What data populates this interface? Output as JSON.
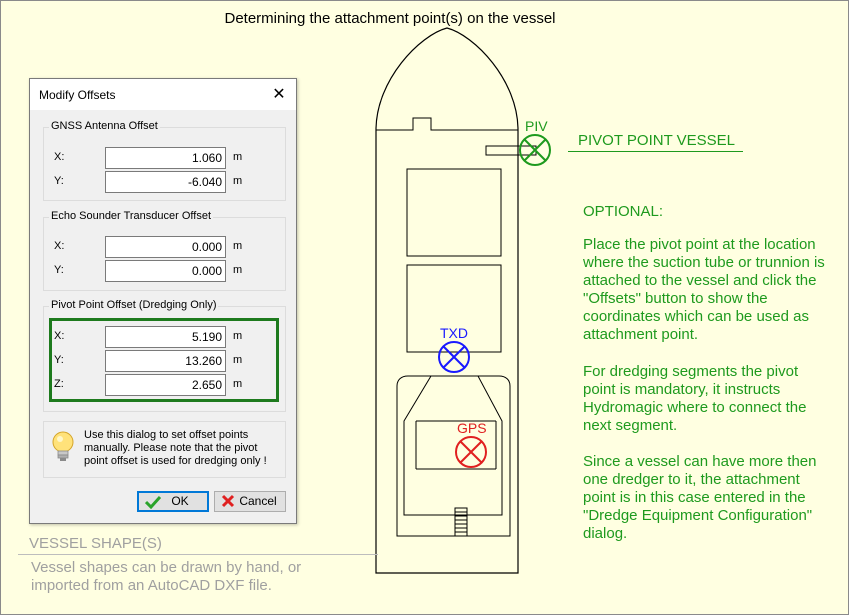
{
  "page": {
    "title": "Determining the attachment point(s) on the vessel"
  },
  "dialog": {
    "title": "Modify Offsets",
    "close_glyph": "✕",
    "gnss": {
      "label": "GNSS Antenna Offset",
      "rows": [
        {
          "axis": "X:",
          "value": "1.060",
          "unit": "m"
        },
        {
          "axis": "Y:",
          "value": "-6.040",
          "unit": "m"
        }
      ]
    },
    "echo": {
      "label": "Echo Sounder Transducer Offset",
      "rows": [
        {
          "axis": "X:",
          "value": "0.000",
          "unit": "m"
        },
        {
          "axis": "Y:",
          "value": "0.000",
          "unit": "m"
        }
      ]
    },
    "pivot": {
      "label": "Pivot Point Offset (Dredging Only)",
      "rows": [
        {
          "axis": "X:",
          "value": "5.190",
          "unit": "m"
        },
        {
          "axis": "Y:",
          "value": "13.260",
          "unit": "m"
        },
        {
          "axis": "Z:",
          "value": "2.650",
          "unit": "m"
        }
      ]
    },
    "tip": "Use this dialog to set offset points manually. Please note that the pivot point offset is used for dredging only !",
    "ok_label": "OK",
    "cancel_label": "Cancel"
  },
  "vessel": {
    "markers": {
      "pivot": "PIV",
      "transducer": "TXD",
      "gps": "GPS"
    }
  },
  "annotations": {
    "pivot_point_vessel": "PIVOT POINT VESSEL",
    "optional": "OPTIONAL:",
    "para1": "Place the pivot point at the location where the suction tube or trunnion is attached to the vessel and click the \"Offsets\" button to show the coordinates which can be used as attachment point.",
    "para2": "For dredging segments the pivot point is mandatory, it instructs Hydromagic where to connect the next segment.",
    "para3": "Since a vessel can have more then one dredger to it, the attachment point is in this case entered in the \"Dredge Equipment Configuration\" dialog.",
    "vessel_shape_heading": "VESSEL SHAPE(S)",
    "vessel_shape_note": "Vessel shapes can be drawn by hand, or imported from an AutoCAD DXF file."
  },
  "colors": {
    "background": "#ffffe1",
    "annotation_green": "#1e9a1e",
    "highlight_box": "#1d7a1d",
    "gps_red": "#e02020",
    "txd_blue": "#1a1aff",
    "muted_gray": "#a0a0a0"
  }
}
